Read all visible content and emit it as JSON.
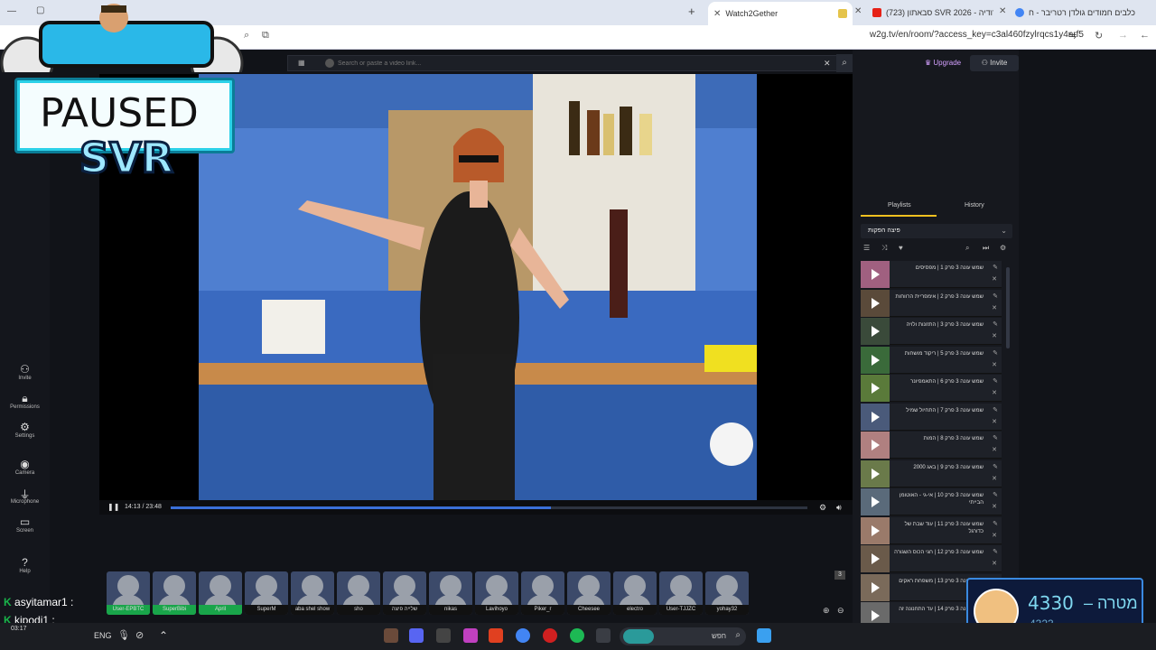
{
  "browser": {
    "tabs": [
      {
        "label": "כלבים חמודים גולדן רטריבר - ח",
        "active": false
      },
      {
        "label": "(723) סבאתון SVR 2026 - פרודיה",
        "active": false
      },
      {
        "label": "Watch2Gether",
        "active": true
      }
    ],
    "url": "w2g.tv/en/room/?access_key=c3al460fzylrqcs1y4nrf5"
  },
  "w2g": {
    "search_placeholder": "Search or paste a video link...",
    "upgrade": "Upgrade",
    "invite": "Invite",
    "time": "14:13 / 23:48",
    "progress": 0.597,
    "rail": [
      {
        "label": "Invite",
        "icon": "add-user-icon"
      },
      {
        "label": "Permissions",
        "icon": "lock-icon"
      },
      {
        "label": "Settings",
        "icon": "gear-icon"
      },
      {
        "label": "Camera",
        "icon": "camera-icon"
      },
      {
        "label": "Microphone",
        "icon": "microphone-icon"
      },
      {
        "label": "Screen",
        "icon": "screen-icon"
      },
      {
        "label": "Help",
        "icon": "help-icon"
      }
    ],
    "panel_tabs": [
      "Playlists",
      "History"
    ],
    "playlist_name": "פיצה הפקות",
    "playlist": [
      "שמש עונה 3 פרק 1 | מפסיסים",
      "שמש עונה 3 פרק 2 | אימפריית הרווחות",
      "שמש עונה 3 פרק 3 | התזונות ולויה",
      "שמש עונה 3 פרק 5 | ריקוד מושחות",
      "שמש עונה 3 פרק 6 | התאמפיונר",
      "שמש עונה 3 פרק 7 | התחיול שמיל",
      "שמש עונה 3 פרק 8 | המות",
      "שמש עונה 3 פרק 9 | באג 2000",
      "שמש עונה 3 פרק 10 | אי-גי - האוטומן הבייתי",
      "שמש עונה 3 פרק 11 | עוד שבת של כדורגל",
      "שמש עונה 3 פרק 12 | חגי הכוס השגורה",
      "שמש עונה 3 פרק 13 | משפחת ראקים",
      "שמש עונה 3 פרק 14 | עד התחנונה זה"
    ],
    "users": [
      "User-EPBTC",
      "SuperBibi",
      "April",
      "SuperM",
      "aba shel show",
      "sho",
      "שלייה פיצה",
      "nikas",
      "Lavihoyo",
      "Piker_r",
      "Cheesee",
      "electro",
      "User-TJJZC",
      "yohay32"
    ],
    "user_count": "3"
  },
  "overlay": {
    "paused": "PAUSED",
    "svr": "SVR",
    "goal_label": "מטרה –",
    "goal_value": "4330",
    "goal_current": "4323",
    "chat": [
      {
        "user": "asyitamar1",
        "badge": "K"
      },
      {
        "user": "kipodi1",
        "badge": "K"
      },
      {
        "user": "kipodi1",
        "badge": "K"
      }
    ]
  },
  "taskbar": {
    "search": "חפש",
    "lang": "ENG",
    "time": "03:17"
  },
  "colors": {
    "accent": "#3a6fd8",
    "green": "#19b54a",
    "panel": "#16181e"
  }
}
